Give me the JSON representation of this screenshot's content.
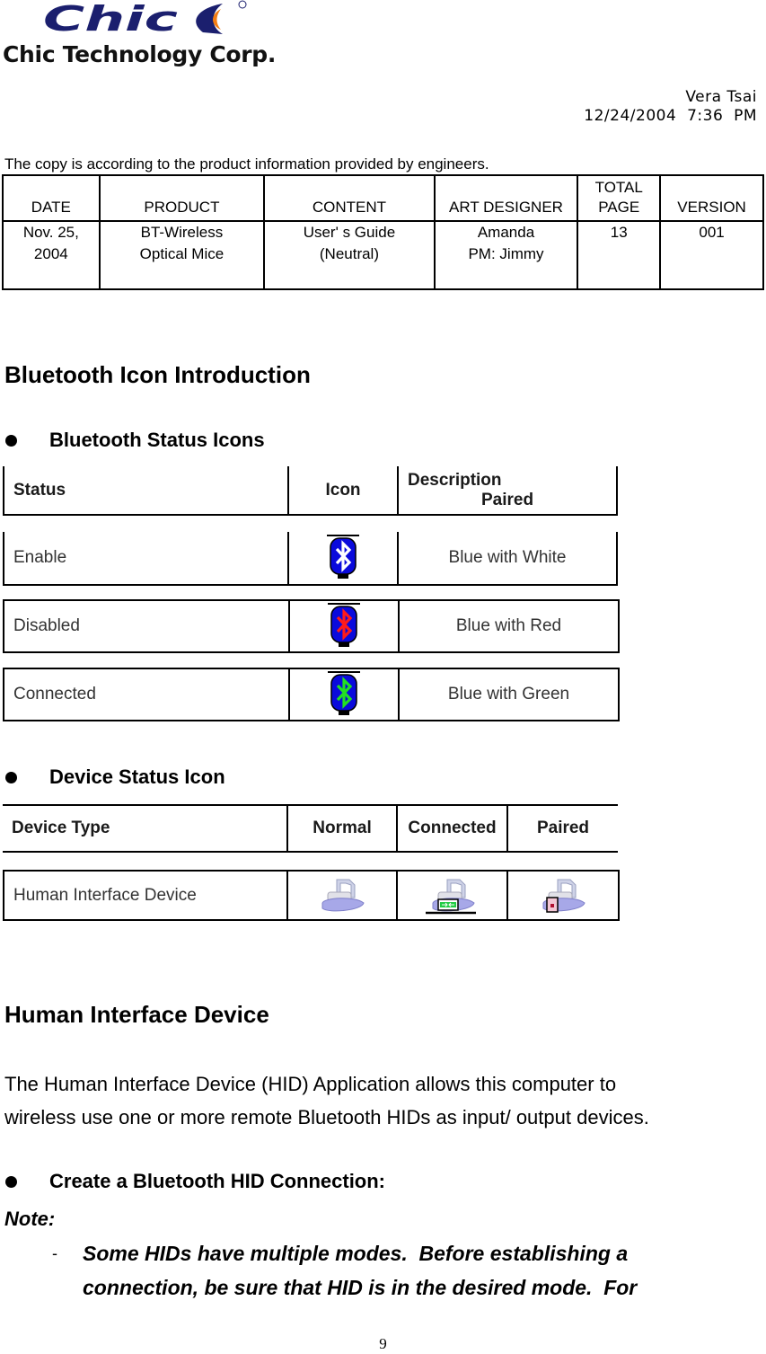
{
  "logo": {
    "brand": "Chic",
    "company": "Chic Technology Corp.",
    "colors": {
      "navy": "#1b1f6e",
      "orange": "#f57d12"
    }
  },
  "author": {
    "name": "Vera Tsai",
    "datetime": "12/24/2004  7:36  PM"
  },
  "copy_note": "The copy is according to the product information provided by engineers.",
  "info_table": {
    "headers": [
      "DATE",
      "PRODUCT",
      "CONTENT",
      "ART DESIGNER",
      "TOTAL PAGE",
      "VERSION"
    ],
    "header_lines": {
      "total_page_1": "TOTAL",
      "total_page_2": "PAGE"
    },
    "values": {
      "date_1": "Nov. 25,",
      "date_2": "2004",
      "product_1": "BT-Wireless",
      "product_2": "Optical Mice",
      "content_1": "User' s Guide",
      "content_2": "(Neutral)",
      "designer_1": "Amanda",
      "designer_2": "PM: Jimmy",
      "total_page": "13",
      "version": "001"
    }
  },
  "section1": {
    "title": "Bluetooth Icon Introduction",
    "bullet": "Bluetooth Status Icons",
    "table": {
      "headers": {
        "status": "Status",
        "icon": "Icon",
        "description": "Description",
        "description_sub": "Paired"
      },
      "rows": [
        {
          "status": "Enable",
          "icon": "bluetooth-white-icon",
          "glyph_color": "#ffffff",
          "description": "Blue with White"
        },
        {
          "status": "Disabled",
          "icon": "bluetooth-red-icon",
          "glyph_color": "#ff1a1a",
          "description": "Blue with Red"
        },
        {
          "status": "Connected",
          "icon": "bluetooth-green-icon",
          "glyph_color": "#22e022",
          "description": "Blue with Green"
        }
      ],
      "icon_bg": "#0a0adc"
    }
  },
  "section2": {
    "bullet": "Device Status Icon",
    "table": {
      "headers": {
        "device_type": "Device Type",
        "normal": "Normal",
        "connected": "Connected",
        "paired": "Paired"
      },
      "rows": [
        {
          "device_type": "Human Interface Device",
          "normal_icon": "hid-normal-icon",
          "connected_icon": "hid-connected-icon",
          "paired_icon": "hid-paired-icon"
        }
      ]
    }
  },
  "section3": {
    "title": "Human Interface Device",
    "paragraph_1": "The Human Interface Device (HID) Application allows this computer to",
    "paragraph_2": "wireless use one or more remote Bluetooth HIDs as input/ output devices.",
    "bullet": "Create a Bluetooth HID Connection:",
    "note_label": "Note:",
    "note_dash": "-",
    "note_line_1": "Some HIDs have multiple modes.  Before establishing a",
    "note_line_2": "connection, be sure that HID is in the desired mode.  For"
  },
  "page_number": "9"
}
